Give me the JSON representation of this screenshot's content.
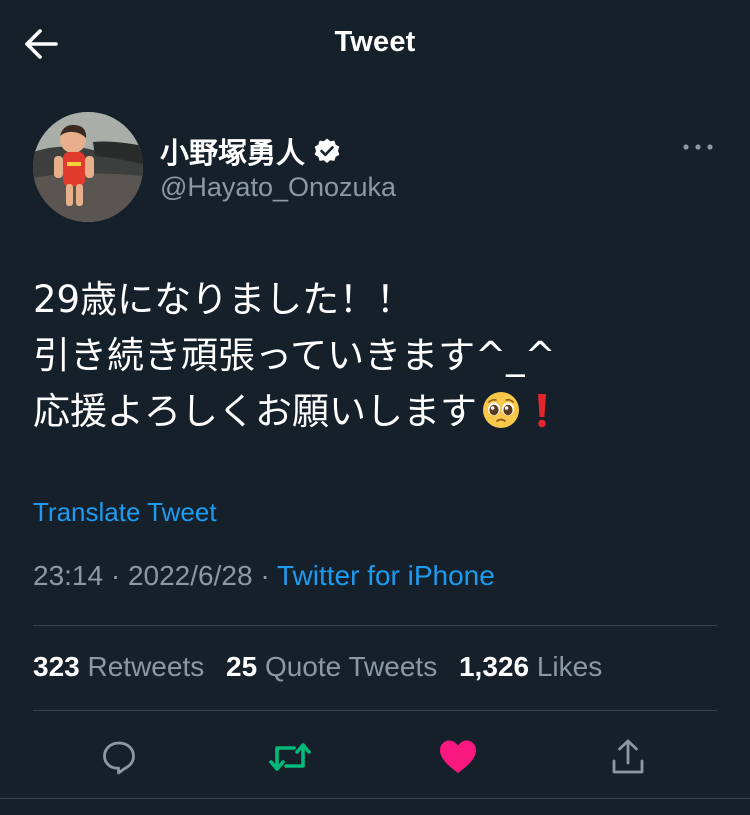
{
  "header": {
    "title": "Tweet",
    "back_icon": "arrow-left-icon"
  },
  "author": {
    "display_name": "小野塚勇人",
    "handle": "@Hayato_Onozuka",
    "verified_icon": "verified-badge-icon",
    "more_icon": "more-horizontal-icon"
  },
  "tweet": {
    "lines": [
      "29歳になりました！！",
      "引き続き頑張っていきます^_^",
      "応援よろしくお願いします"
    ],
    "emoji": [
      "pleading-face-emoji",
      "red-exclamation-emoji"
    ]
  },
  "translate": {
    "label": "Translate Tweet"
  },
  "meta": {
    "time": "23:14",
    "separator": " · ",
    "date": "2022/6/28",
    "source": "Twitter for iPhone"
  },
  "stats": {
    "retweets": {
      "count": "323",
      "label": "Retweets"
    },
    "quotes": {
      "count": "25",
      "label": "Quote Tweets"
    },
    "likes": {
      "count": "1,326",
      "label": "Likes"
    }
  },
  "actions": {
    "reply_icon": "reply-icon",
    "retweet_icon": "retweet-icon",
    "like_icon": "heart-icon",
    "share_icon": "share-icon"
  },
  "colors": {
    "background": "#15202b",
    "secondary_text": "#8b98a5",
    "link": "#1d9bf0",
    "retweet_active": "#00ba7c",
    "like_active": "#f91880",
    "divider": "#38444d"
  }
}
